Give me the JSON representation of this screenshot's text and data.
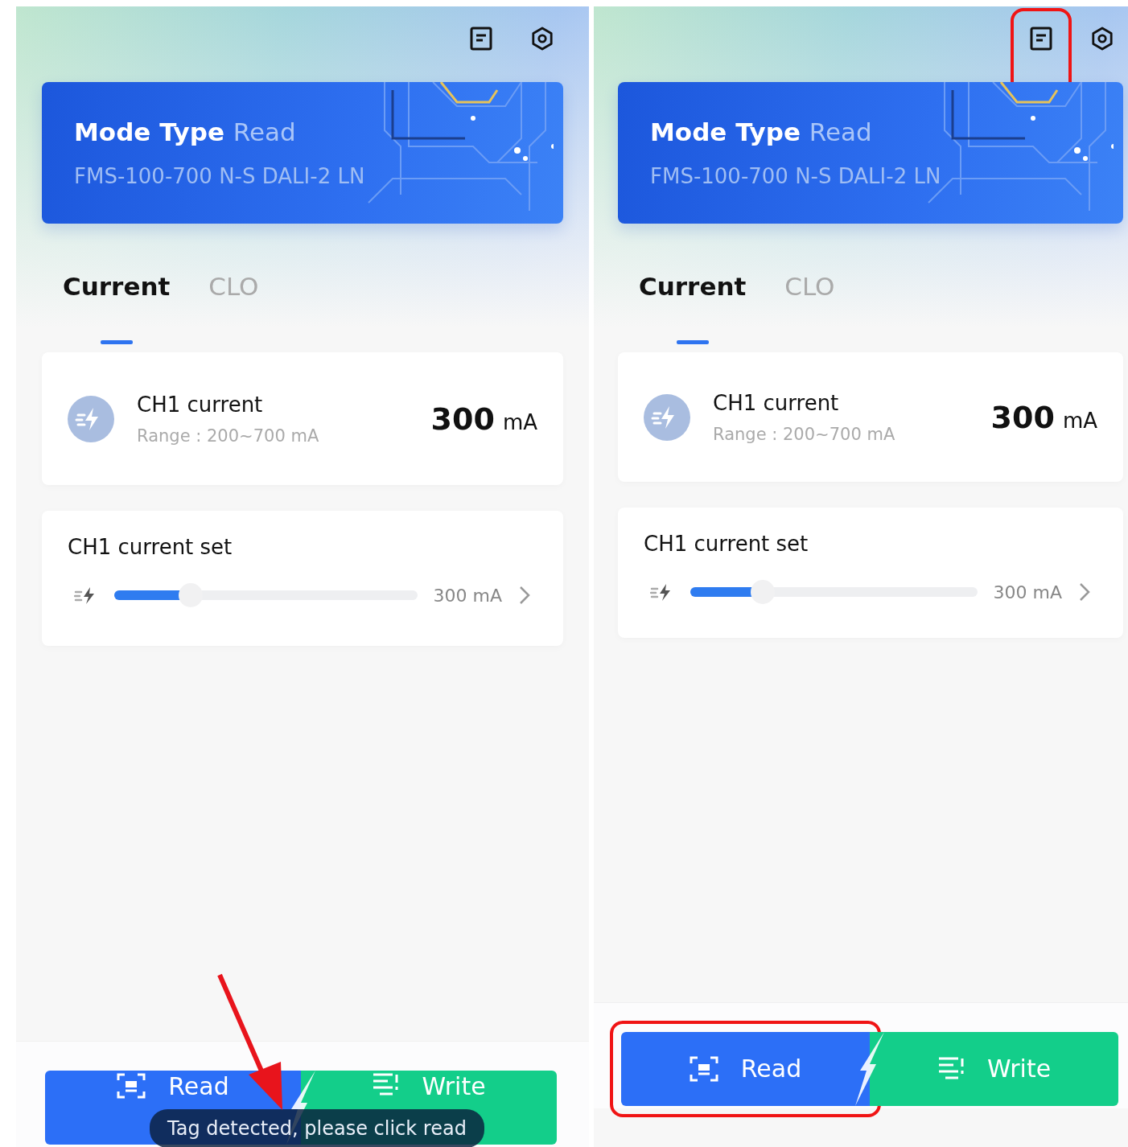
{
  "screens": [
    {
      "toolbar": {
        "notes_highlighted": false
      },
      "mode_card": {
        "title": "Mode Type",
        "mode": "Read",
        "model": "FMS-100-700 N-S DALI-2 LN"
      },
      "tabs": [
        {
          "label": "Current",
          "selected": true
        },
        {
          "label": "CLO",
          "selected": false
        }
      ],
      "readout": {
        "label": "CH1 current",
        "range": "Range : 200~700 mA",
        "value": "300",
        "unit": "mA"
      },
      "setting": {
        "label": "CH1 current set",
        "level": 0.23,
        "reading": "300 mA"
      },
      "actions": [
        {
          "kind": "read",
          "label": "Read",
          "highlighted": false
        },
        {
          "kind": "write",
          "label": "Write",
          "highlighted": false
        }
      ],
      "toast": "Tag detected, please click read",
      "arrow": true
    },
    {
      "toolbar": {
        "notes_highlighted": true
      },
      "mode_card": {
        "title": "Mode Type",
        "mode": "Read",
        "model": "FMS-100-700 N-S DALI-2 LN"
      },
      "tabs": [
        {
          "label": "Current",
          "selected": true
        },
        {
          "label": "CLO",
          "selected": false
        }
      ],
      "readout": {
        "label": "CH1 current",
        "range": "Range : 200~700 mA",
        "value": "300",
        "unit": "mA"
      },
      "setting": {
        "label": "CH1 current set",
        "level": 0.23,
        "reading": "300 mA"
      },
      "actions": [
        {
          "kind": "read",
          "label": "Read",
          "highlighted": true
        },
        {
          "kind": "write",
          "label": "Write",
          "highlighted": false
        }
      ],
      "arrow": false
    }
  ]
}
